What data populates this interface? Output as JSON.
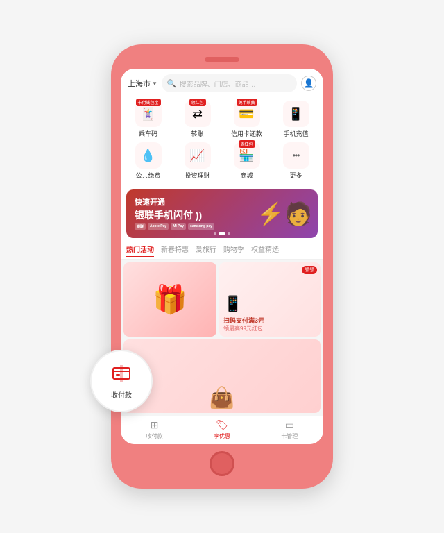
{
  "phone": {
    "header": {
      "location": "上海市",
      "search_placeholder": "搜索品牌、门店、商品…",
      "user_icon": "👤"
    },
    "quick_actions": {
      "row1": [
        {
          "id": "card-code",
          "icon": "🃏",
          "label": "乘车码",
          "badge": "卡付钱包宝"
        },
        {
          "id": "transfer",
          "icon": "↔️",
          "label": "转账",
          "badge": "领红包"
        },
        {
          "id": "credit",
          "icon": "💳",
          "label": "信用卡还款",
          "badge": "免手续费"
        },
        {
          "id": "recharge",
          "icon": "📱",
          "label": "手机充值",
          "badge": null
        }
      ],
      "row2": [
        {
          "id": "utility",
          "icon": "💧",
          "label": "公共缴费",
          "badge": null
        },
        {
          "id": "invest",
          "icon": "📈",
          "label": "投资理财",
          "badge": null
        },
        {
          "id": "mall",
          "icon": "🏪",
          "label": "商城",
          "badge": "周红包"
        },
        {
          "id": "more",
          "icon": "···",
          "label": "更多",
          "badge": null
        }
      ]
    },
    "banner": {
      "title": "快速开通",
      "subtitle": "银联手机闪付 ))",
      "logos": [
        "银联",
        "Apple Pay",
        "Mi Pay",
        "samsung pay"
      ],
      "deco": "⚡"
    },
    "tabs": [
      {
        "id": "hot",
        "label": "热门活动",
        "active": true
      },
      {
        "id": "spring",
        "label": "新春特惠",
        "active": false
      },
      {
        "id": "travel",
        "label": "爱旅行",
        "active": false
      },
      {
        "id": "shopping",
        "label": "购物季",
        "active": false
      },
      {
        "id": "benefits",
        "label": "权益精选",
        "active": false
      }
    ],
    "content": {
      "card_top_left_icon": "🎁",
      "card_top_right_title": "扫码支付满3元",
      "card_top_right_sub": "领最高99元红包",
      "card_top_right_badge": "领领",
      "card_bottom_icon": "👜"
    },
    "bottom_nav": [
      {
        "id": "pay",
        "icon": "▦",
        "label": "收付款",
        "active": false
      },
      {
        "id": "benefits2",
        "icon": "🏷",
        "label": "享优惠",
        "active": true
      },
      {
        "id": "card-mgmt",
        "icon": "▭",
        "label": "卡管理",
        "active": false
      }
    ],
    "floating": {
      "icon": "▦",
      "label": "收付款"
    }
  }
}
